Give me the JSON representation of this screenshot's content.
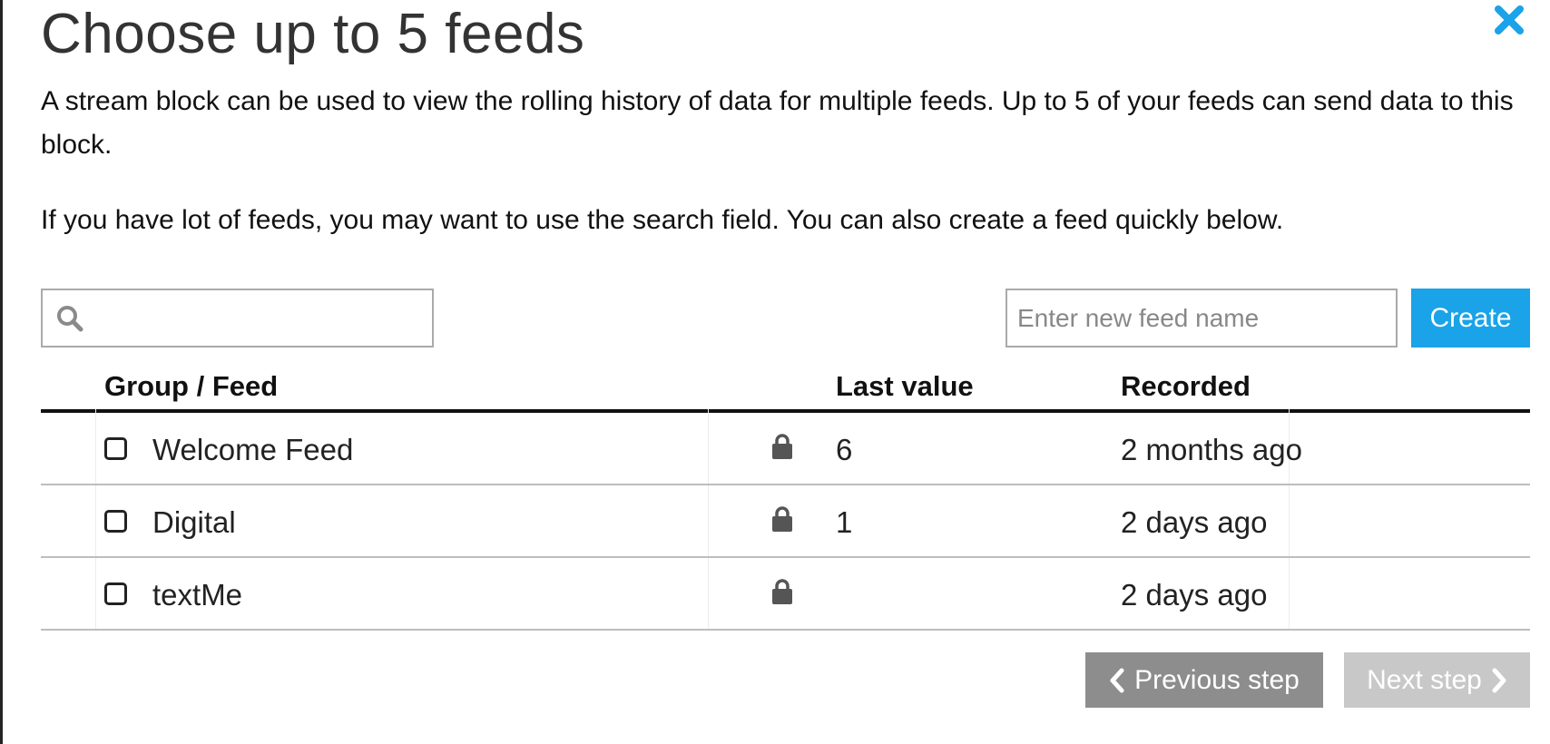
{
  "modal": {
    "title": "Choose up to 5 feeds",
    "description_1": "A stream block can be used to view the rolling history of data for multiple feeds. Up to 5 of your feeds can send data to this block.",
    "description_2": "If you have lot of feeds, you may want to use the search field. You can also create a feed quickly below.",
    "close_icon": "close-icon"
  },
  "search": {
    "value": "",
    "icon": "search-icon"
  },
  "new_feed": {
    "placeholder": "Enter new feed name",
    "value": "",
    "create_label": "Create"
  },
  "table": {
    "headers": {
      "group_feed": "Group / Feed",
      "last_value": "Last value",
      "recorded": "Recorded"
    },
    "rows": [
      {
        "name": "Welcome Feed",
        "locked": true,
        "last_value": "6",
        "recorded": "2 months ago"
      },
      {
        "name": "Digital",
        "locked": true,
        "last_value": "1",
        "recorded": "2 days ago"
      },
      {
        "name": "textMe",
        "locked": true,
        "last_value": "",
        "recorded": "2 days ago"
      }
    ]
  },
  "footer": {
    "previous_label": "Previous step",
    "next_label": "Next step"
  },
  "colors": {
    "accent": "#1aa3e8",
    "previous_button": "#8d8d8d",
    "next_button_disabled": "#c8c8c8"
  }
}
